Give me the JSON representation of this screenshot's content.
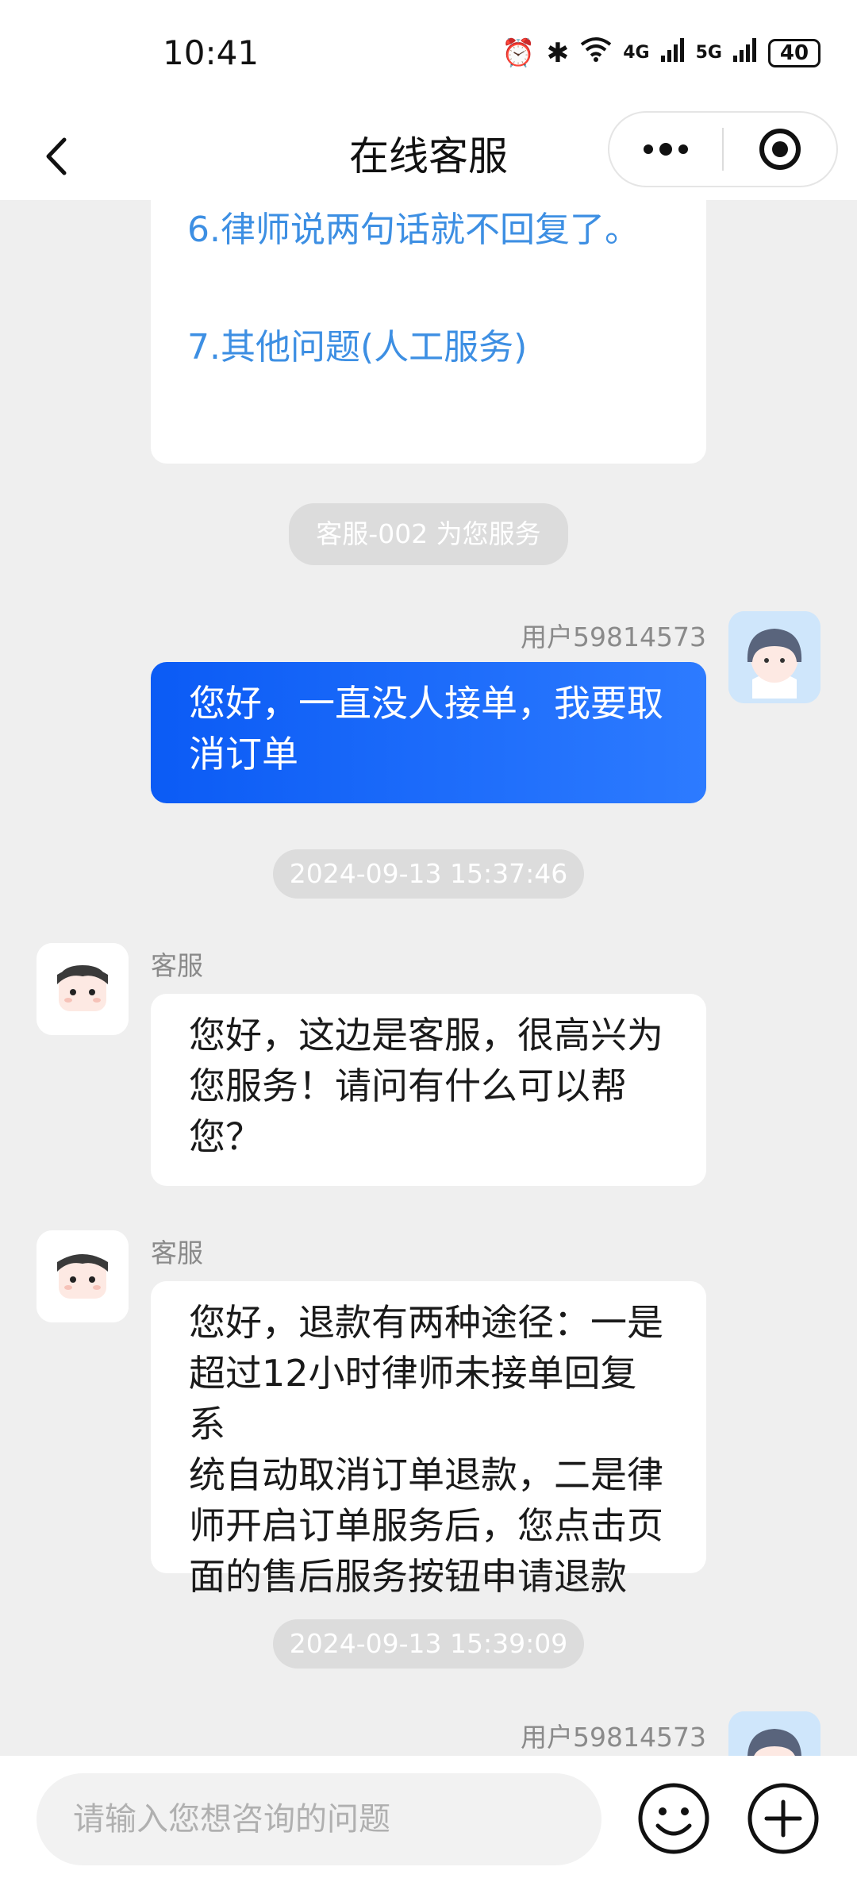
{
  "status_bar": {
    "time": "10:41",
    "network_4g": "4G",
    "network_5g": "5G",
    "battery": "40"
  },
  "nav": {
    "title": "在线客服"
  },
  "menu_options": [
    "6.律师说两句话就不回复了。",
    "7.其他问题(人工服务)"
  ],
  "agent_join_notice": "客服-002 为您服务",
  "messages": [
    {
      "sender": "用户59814573",
      "type": "user",
      "lines": [
        "您好，一直没人接单，我要取",
        "消订单"
      ]
    },
    {
      "timestamp": "2024-09-13 15:37:46"
    },
    {
      "sender": "客服",
      "type": "agent",
      "lines": [
        "您好，这边是客服，很高兴为",
        "您服务！请问有什么可以帮",
        "您？"
      ]
    },
    {
      "sender": "客服",
      "type": "agent",
      "lines": [
        "您好，退款有两种途径：一是",
        "超过12小时律师未接单回复系",
        "统自动取消订单退款，二是律",
        "师开启订单服务后，您点击页",
        "面的售后服务按钮申请退款"
      ]
    },
    {
      "timestamp": "2024-09-13 15:39:09"
    },
    {
      "sender": "用户59814573",
      "type": "user"
    }
  ],
  "input": {
    "placeholder": "请输入您想咨询的问题",
    "value": ""
  },
  "icons": {
    "back": "chevron-left-icon",
    "more": "more-dots-icon",
    "close": "target-close-icon",
    "emoji": "smiley-icon",
    "plus": "plus-icon"
  },
  "colors": {
    "user_bubble": "#0b5bf5",
    "menu_link": "#3d8fe3",
    "background": "#efefef"
  }
}
